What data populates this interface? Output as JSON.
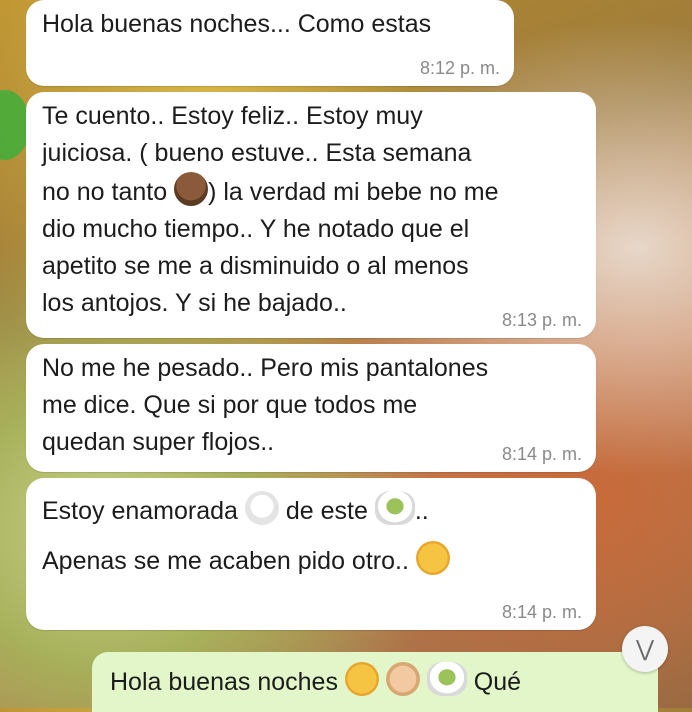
{
  "messages": [
    {
      "text": "Hola buenas noches... Como estas",
      "time": "8:12 p. m."
    },
    {
      "text_a": "Te cuento.. Estoy feliz.. Estoy muy\njuiciosa. ( bueno estuve.. Esta semana\nno no tanto ",
      "text_b": ") la verdad mi bebe no me\ndio mucho tiempo.. Y he notado que el\napetito se me a disminuido o al menos\nlos antojos. Y si he bajado..",
      "time": "8:13 p. m."
    },
    {
      "text": "No me he pesado.. Pero mis pantalones\nme dice. Que si por que todos me\nquedan super flojos..",
      "time": "8:14 p. m."
    },
    {
      "text_a": "Estoy enamorada ",
      "text_b": " de este ",
      "text_c": "..",
      "line2": "Apenas se me acaben pido otro.. ",
      "time": "8:14 p. m."
    }
  ],
  "outgoing": {
    "text_a": "Hola buenas noches ",
    "text_b": " Qué"
  },
  "scroll_button": {
    "icon": "double-chevron-down-icon"
  },
  "colors": {
    "bubble_in": "#ffffff",
    "bubble_out": "#e2f6c9",
    "timestamp": "#8a8a8a"
  }
}
